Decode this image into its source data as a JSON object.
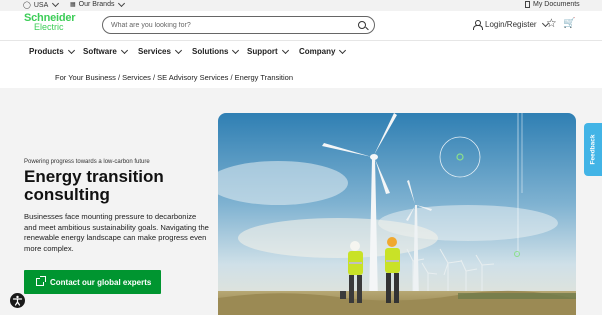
{
  "topbar": {
    "country": "USA",
    "brands": "Our Brands",
    "documents": "My Documents"
  },
  "header": {
    "logo_line1": "Schneider",
    "logo_line2": "Electric",
    "search_placeholder": "What are you looking for?",
    "login": "Login/Register"
  },
  "nav": {
    "items": [
      {
        "label": "Products"
      },
      {
        "label": "Software"
      },
      {
        "label": "Services"
      },
      {
        "label": "Solutions"
      },
      {
        "label": "Support"
      },
      {
        "label": "Company"
      }
    ]
  },
  "breadcrumb": "For Your Business  / Services  / SE Advisory Services  / Energy Transition",
  "hero": {
    "eyebrow": "Powering progress towards a low-carbon future",
    "title": "Energy transition consulting",
    "description": "Businesses face mounting pressure to decarbonize and meet ambitious sustainability goals. Navigating the renewable energy landscape can make progress even more complex.",
    "cta": "Contact our global experts"
  },
  "feedback": "Feedback",
  "colors": {
    "brand_green": "#3dcd58",
    "cta_green": "#009530",
    "feedback_blue": "#42b4e6"
  }
}
